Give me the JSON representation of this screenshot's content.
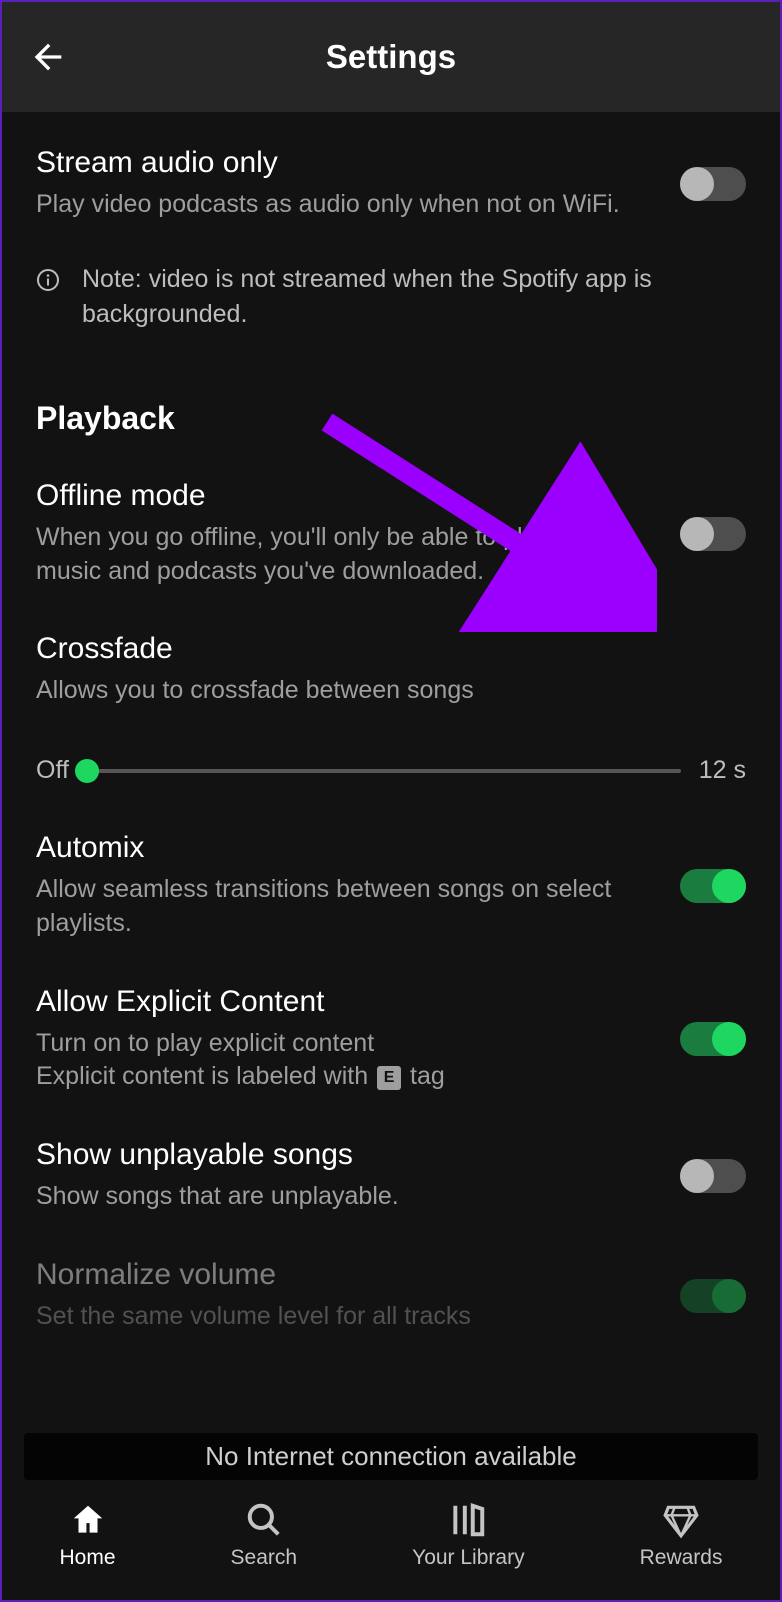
{
  "header": {
    "title": "Settings"
  },
  "settings": {
    "stream_audio_only": {
      "title": "Stream audio only",
      "desc": "Play video podcasts as audio only when not on WiFi.",
      "on": false
    },
    "info_note": "Note: video is not streamed when the Spotify app is backgrounded.",
    "playback_header": "Playback",
    "offline_mode": {
      "title": "Offline mode",
      "desc": "When you go offline, you'll only be able to play the music and podcasts you've downloaded.",
      "on": false
    },
    "crossfade": {
      "title": "Crossfade",
      "desc": "Allows you to crossfade between songs",
      "min_label": "Off",
      "max_label": "12 s",
      "value": 0
    },
    "automix": {
      "title": "Automix",
      "desc": "Allow seamless transitions between songs on select playlists.",
      "on": true
    },
    "explicit": {
      "title": "Allow Explicit Content",
      "desc_line1": "Turn on to play explicit content",
      "desc_line2a": "Explicit content is labeled with ",
      "desc_line2b": " tag",
      "tag_letter": "E",
      "on": true
    },
    "unplayable": {
      "title": "Show unplayable songs",
      "desc": "Show songs that are unplayable.",
      "on": false
    },
    "normalize": {
      "title": "Normalize volume",
      "desc": "Set the same volume level for all tracks",
      "on": true
    }
  },
  "toast": "No Internet connection available",
  "nav": {
    "home": "Home",
    "search": "Search",
    "library": "Your Library",
    "rewards": "Rewards"
  }
}
